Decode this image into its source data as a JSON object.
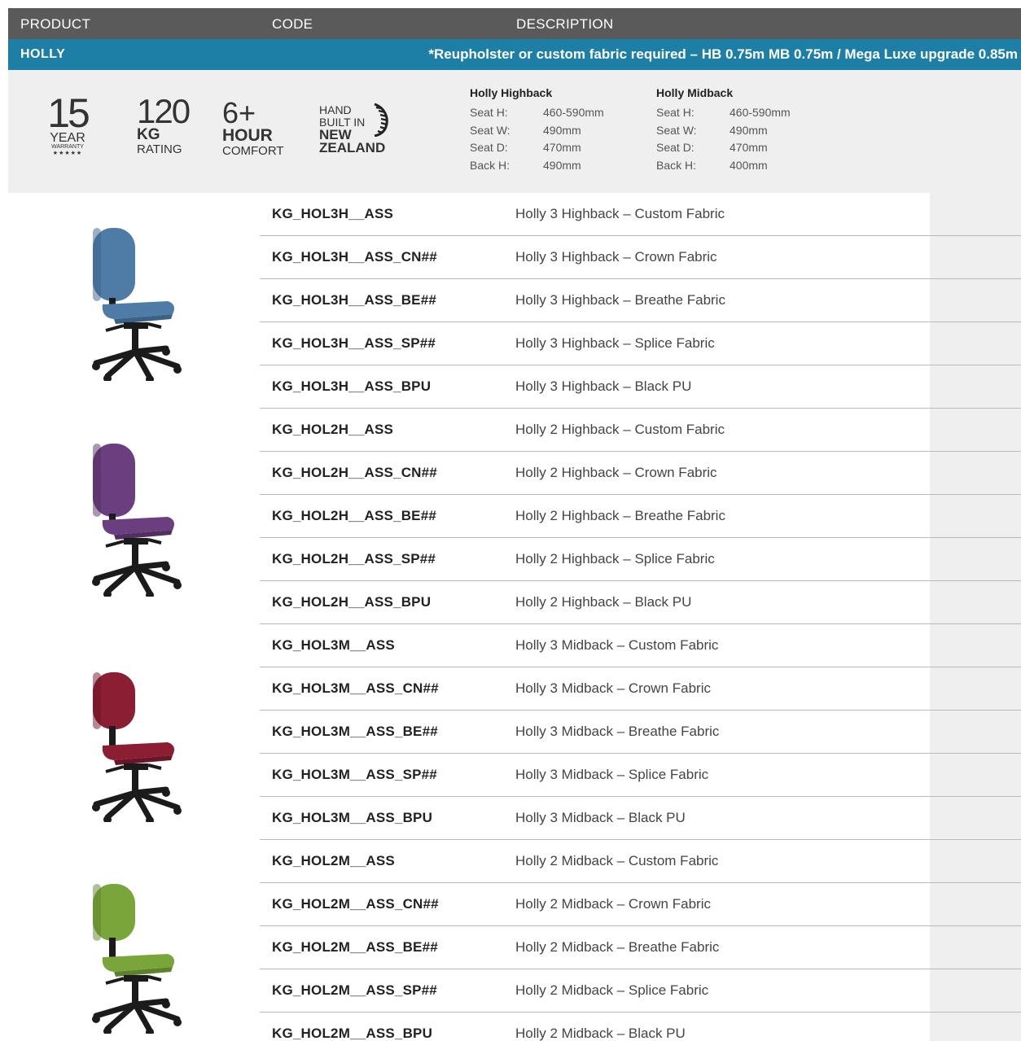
{
  "header": {
    "product": "PRODUCT",
    "code": "CODE",
    "description": "DESCRIPTION"
  },
  "product_bar": {
    "name": "HOLLY",
    "note": "*Reupholster or custom fabric required – HB 0.75m MB 0.75m / Mega Luxe upgrade 0.85m"
  },
  "badges": {
    "warranty": {
      "num": "15",
      "year": "YEAR",
      "sub": "WARRANTY",
      "stars": "★★★★★"
    },
    "kg": {
      "num": "120",
      "unit": "KG",
      "label": "RATING"
    },
    "hour": {
      "num": "6+",
      "unit": "HOUR",
      "label": "COMFORT"
    },
    "nz": {
      "l1": "HAND",
      "l2": "BUILT IN",
      "l3": "NEW",
      "l4": "ZEALAND"
    }
  },
  "specs": {
    "highback": {
      "title": "Holly Highback",
      "rows": [
        {
          "k": "Seat H:",
          "v": "460-590mm"
        },
        {
          "k": "Seat W:",
          "v": "490mm"
        },
        {
          "k": "Seat D:",
          "v": "470mm"
        },
        {
          "k": "Back H:",
          "v": "490mm"
        }
      ]
    },
    "midback": {
      "title": "Holly Midback",
      "rows": [
        {
          "k": "Seat H:",
          "v": "460-590mm"
        },
        {
          "k": "Seat W:",
          "v": "490mm"
        },
        {
          "k": "Seat D:",
          "v": "470mm"
        },
        {
          "k": "Back H:",
          "v": "400mm"
        }
      ]
    }
  },
  "chairs": [
    {
      "name": "holly-3-highback",
      "color": "#4f7ca6",
      "dark": "#3c6186"
    },
    {
      "name": "holly-2-highback",
      "color": "#6b3f7f",
      "dark": "#522f62"
    },
    {
      "name": "holly-3-midback",
      "color": "#8b1e32",
      "dark": "#6b1626"
    },
    {
      "name": "holly-2-midback",
      "color": "#79a53a",
      "dark": "#5e822b"
    }
  ],
  "rows": [
    {
      "code": "KG_HOL3H__ASS",
      "desc": "Holly 3 Highback – Custom Fabric"
    },
    {
      "code": "KG_HOL3H__ASS_CN##",
      "desc": "Holly 3 Highback – Crown Fabric"
    },
    {
      "code": "KG_HOL3H__ASS_BE##",
      "desc": "Holly 3 Highback – Breathe Fabric"
    },
    {
      "code": "KG_HOL3H__ASS_SP##",
      "desc": "Holly 3 Highback – Splice Fabric"
    },
    {
      "code": "KG_HOL3H__ASS_BPU",
      "desc": "Holly 3 Highback – Black PU"
    },
    {
      "code": "KG_HOL2H__ASS",
      "desc": "Holly 2 Highback – Custom Fabric"
    },
    {
      "code": "KG_HOL2H__ASS_CN##",
      "desc": "Holly 2 Highback – Crown Fabric"
    },
    {
      "code": "KG_HOL2H__ASS_BE##",
      "desc": "Holly 2 Highback – Breathe Fabric"
    },
    {
      "code": "KG_HOL2H__ASS_SP##",
      "desc": "Holly 2 Highback – Splice Fabric"
    },
    {
      "code": "KG_HOL2H__ASS_BPU",
      "desc": "Holly 2 Highback – Black PU"
    },
    {
      "code": "KG_HOL3M__ASS",
      "desc": "Holly 3 Midback – Custom Fabric"
    },
    {
      "code": "KG_HOL3M__ASS_CN##",
      "desc": "Holly 3 Midback – Crown Fabric"
    },
    {
      "code": "KG_HOL3M__ASS_BE##",
      "desc": "Holly 3 Midback – Breathe Fabric"
    },
    {
      "code": "KG_HOL3M__ASS_SP##",
      "desc": "Holly 3 Midback – Splice Fabric"
    },
    {
      "code": "KG_HOL3M__ASS_BPU",
      "desc": "Holly 3 Midback – Black PU"
    },
    {
      "code": "KG_HOL2M__ASS",
      "desc": "Holly 2 Midback – Custom Fabric"
    },
    {
      "code": "KG_HOL2M__ASS_CN##",
      "desc": "Holly 2 Midback – Crown Fabric"
    },
    {
      "code": "KG_HOL2M__ASS_BE##",
      "desc": "Holly 2 Midback – Breathe Fabric"
    },
    {
      "code": "KG_HOL2M__ASS_SP##",
      "desc": "Holly 2 Midback – Splice Fabric"
    },
    {
      "code": "KG_HOL2M__ASS_BPU",
      "desc": "Holly 2 Midback – Black PU"
    }
  ]
}
